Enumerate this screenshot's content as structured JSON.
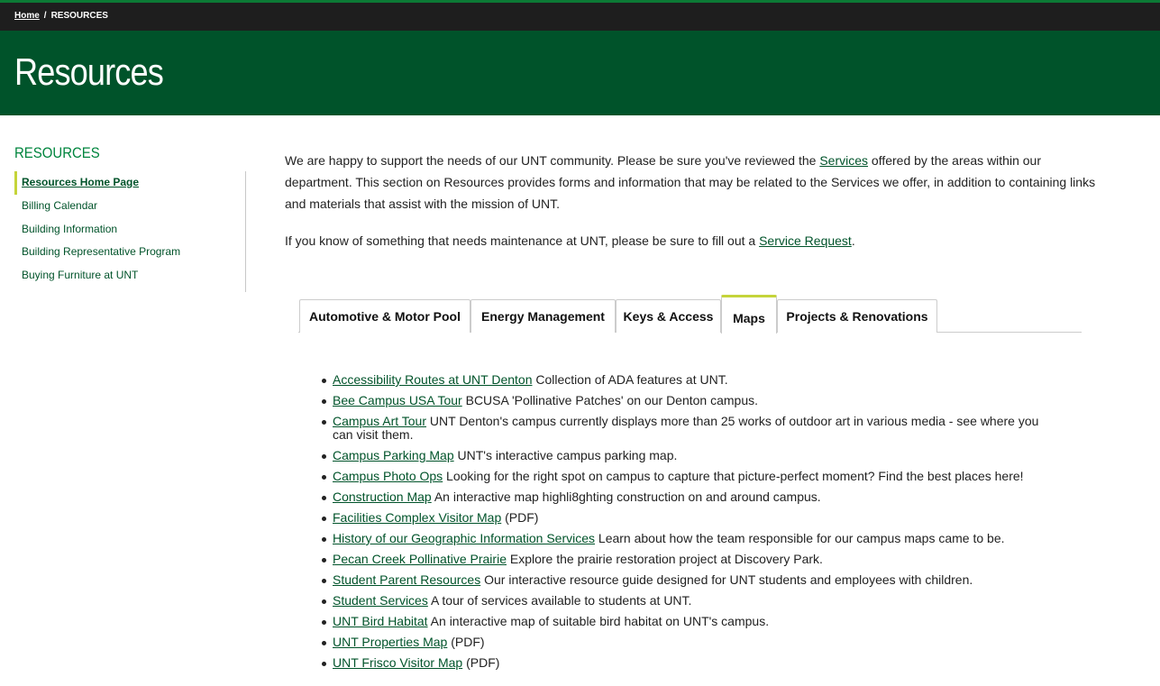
{
  "breadcrumb": {
    "home": "Home",
    "separator": "/",
    "current": "RESOURCES"
  },
  "hero": {
    "title": "Resources"
  },
  "sidebar": {
    "title": "RESOURCES",
    "items": [
      {
        "label": "Resources Home Page"
      },
      {
        "label": "Billing Calendar"
      },
      {
        "label": "Building Information"
      },
      {
        "label": "Building Representative Program"
      },
      {
        "label": "Buying Furniture at UNT"
      }
    ]
  },
  "intro": {
    "p1_before": "We are happy to support the needs of our UNT community. Please be sure you've reviewed the ",
    "p1_link": "Services",
    "p1_after": " offered by the areas within our department. This section on Resources provides forms and information that may be related to the Services we offer, in addition to containing links and materials that assist with the mission of UNT.",
    "p2_before": "If you know of something that needs maintenance at UNT, please be sure to fill out a ",
    "p2_link": "Service Request",
    "p2_after": "."
  },
  "tabs": [
    {
      "label": "Automotive & Motor Pool"
    },
    {
      "label": "Energy Management"
    },
    {
      "label": "Keys & Access"
    },
    {
      "label": "Maps"
    },
    {
      "label": "Projects & Renovations"
    }
  ],
  "maps": [
    {
      "link": "Accessibility Routes at UNT Denton",
      "desc": " Collection of ADA features at UNT."
    },
    {
      "link": "Bee Campus USA Tour",
      "desc": " BCUSA 'Pollinative Patches' on our Denton campus."
    },
    {
      "link": "Campus Art Tour",
      "desc": " UNT Denton's campus currently displays more than 25 works of outdoor art in various media - see where you can visit them."
    },
    {
      "link": "Campus Parking Map",
      "desc": " UNT's interactive campus parking map."
    },
    {
      "link": "Campus Photo Ops",
      "desc": " Looking for the right spot on campus to capture that picture-perfect moment? Find the best places here!"
    },
    {
      "link": "Construction Map",
      "desc": " An interactive map highli8ghting construction on and around campus."
    },
    {
      "link": "Facilities Complex Visitor Map",
      "desc": " (PDF)"
    },
    {
      "link": "History of our Geographic Information Services",
      "desc": " Learn about how the team responsible for our campus maps came to be."
    },
    {
      "link": "Pecan Creek Pollinative Prairie",
      "desc": " Explore the prairie restoration project at Discovery Park."
    },
    {
      "link": "Student Parent Resources",
      "desc": " Our interactive resource guide designed for UNT students and employees with children."
    },
    {
      "link": "Student Services",
      "desc": " A tour of services available to students at UNT."
    },
    {
      "link": "UNT Bird Habitat",
      "desc": " An interactive map of suitable bird habitat on UNT's campus."
    },
    {
      "link": "UNT Properties Map",
      "desc": " (PDF)"
    },
    {
      "link": "UNT Frisco Visitor Map",
      "desc": " (PDF)"
    }
  ],
  "colors": {
    "brand_green": "#00532a",
    "accent_green": "#00853e",
    "tab_accent": "#c5d43a",
    "topbar": "#1e1e1e"
  }
}
